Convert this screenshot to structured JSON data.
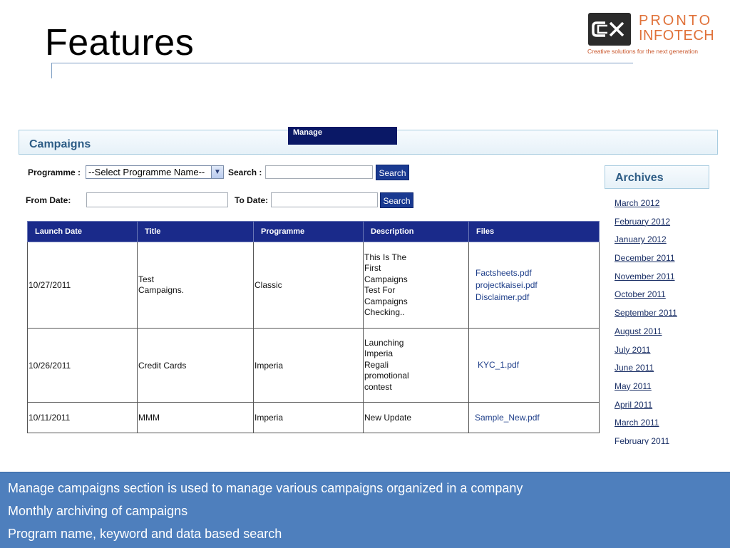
{
  "slide": {
    "title": "Features"
  },
  "logo": {
    "line1": "PRONTO",
    "line2": "INFOTECH",
    "tagline": "Creative solutions for the next generation"
  },
  "app": {
    "section_title": "Campaigns",
    "manage_tab": "Manage",
    "filters": {
      "programme_label": "Programme :",
      "programme_selected": "--Select Programme Name--",
      "search_label": "Search :",
      "search_value": "",
      "search_button": "Search",
      "from_date_label": "From Date:",
      "from_date_value": "",
      "to_date_label": "To Date:",
      "to_date_value": "",
      "date_search_button": "Search"
    },
    "table": {
      "columns": [
        "Launch Date",
        "Title",
        "Programme",
        "Description",
        "Files"
      ],
      "rows": [
        {
          "launch_date": "10/27/2011",
          "title": "Test Campaigns.",
          "programme": "Classic",
          "description": "This Is The First Campaigns Test For Campaigns Checking..",
          "files": [
            "Factsheets.pdf",
            "projectkaisei.pdf",
            "Disclaimer.pdf"
          ]
        },
        {
          "launch_date": "10/26/2011",
          "title": "Credit Cards",
          "programme": "Imperia",
          "description": "Launching Imperia Regali promotional contest",
          "files": [
            "KYC_1.pdf"
          ]
        },
        {
          "launch_date": "10/11/2011",
          "title": "MMM",
          "programme": "Imperia",
          "description": "New Update",
          "files": [
            "Sample_New.pdf"
          ]
        }
      ]
    },
    "archives": {
      "title": "Archives",
      "items": [
        "March 2012",
        "February 2012",
        "January 2012",
        "December 2011",
        "November 2011",
        "October 2011",
        "September 2011",
        "August 2011",
        "July 2011",
        "June 2011",
        "May 2011",
        "April 2011",
        "March 2011",
        "February 2011"
      ]
    }
  },
  "bullets": [
    "Manage campaigns section is used to manage various campaigns organized in a company",
    "Monthly archiving of campaigns",
    "Program name, keyword and data based search"
  ]
}
